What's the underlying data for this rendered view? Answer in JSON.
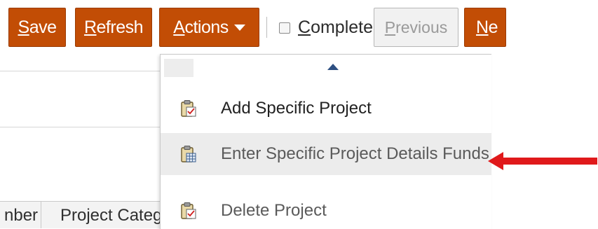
{
  "toolbar": {
    "save_label": "ave",
    "save_mnemonic": "S",
    "refresh_label": "efresh",
    "refresh_mnemonic": "R",
    "actions_label": "ctions",
    "actions_mnemonic": "A",
    "complete_label": "omplete",
    "complete_mnemonic": "C",
    "complete_checked": false,
    "previous_label": "revious",
    "previous_mnemonic": "P",
    "next_label_visible": "e",
    "next_mnemonic": "N"
  },
  "menu": {
    "items": [
      {
        "label": "Add Specific Project",
        "icon": "clipboard-check-icon"
      },
      {
        "label": "Enter Specific Project Details Funds",
        "icon": "clipboard-grid-icon"
      },
      {
        "label": "Delete Project",
        "icon": "clipboard-check-icon"
      }
    ]
  },
  "table": {
    "columns": [
      "nber",
      "Project Catego"
    ]
  },
  "colors": {
    "button_bg": "#c24d05",
    "arrow_red": "#e0191b",
    "menu_highlight": "#ececec"
  }
}
